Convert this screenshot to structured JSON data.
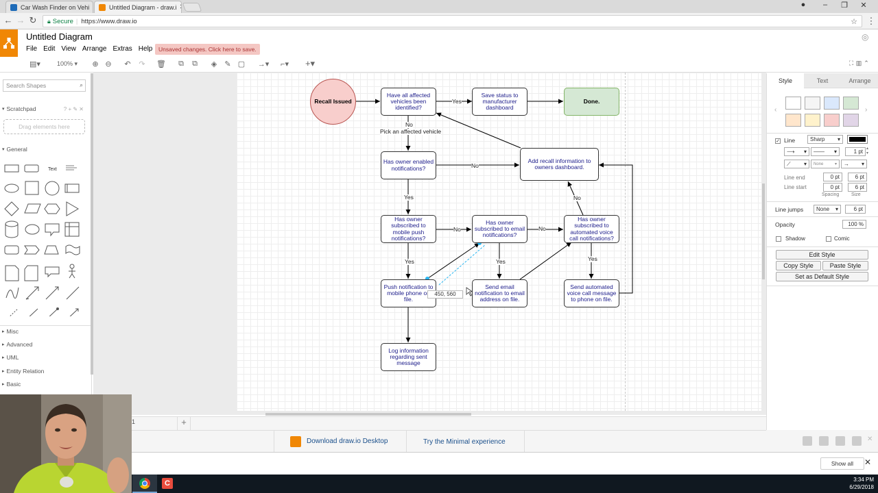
{
  "browser": {
    "tabs": [
      {
        "title": "Car Wash Finder on Vehi",
        "active": false
      },
      {
        "title": "Untitled Diagram - draw.i",
        "active": true
      }
    ],
    "secure_label": "Secure",
    "url": "https://www.draw.io"
  },
  "app": {
    "title": "Untitled Diagram",
    "menu": [
      "File",
      "Edit",
      "View",
      "Arrange",
      "Extras",
      "Help"
    ],
    "unsaved_notice": "Unsaved changes. Click here to save.",
    "zoom": "100%"
  },
  "sidebar": {
    "search_placeholder": "Search Shapes",
    "scratchpad_label": "Scratchpad",
    "scratchpad_hint": "Drag elements here",
    "general_label": "General",
    "text_shape_label": "Text",
    "sections": [
      "Misc",
      "Advanced",
      "UML",
      "Entity Relation",
      "Basic"
    ]
  },
  "diagram": {
    "nodes": {
      "recall": "Recall Issued",
      "identified": "Have all affected vehicles been identified?",
      "save_status": "Save status to manufacturer dashboard",
      "done": "Done.",
      "enabled": "Has owner enabled notifications?",
      "add_recall": "Add recall information to owners dashboard.",
      "push_sub": "Has owner subscribed to mobile push notifications?",
      "email_sub": "Has owner subscribed to email notifications?",
      "voice_sub": "Has owner subscribed to automated voice call notifications?",
      "push_send": "Push notification to mobile phone on file.",
      "email_send": "Send email notification to email address on file.",
      "voice_send": "Send automated voice call message to phone on file.",
      "log": "Log information regarding sent message"
    },
    "edge_labels": {
      "yes_top": "Yes",
      "no_top": "No",
      "pick": "Pick an affected vehicle",
      "no_enabled": "No",
      "yes_enabled": "Yes",
      "no_push": "No",
      "no_email": "No",
      "yes_push": "Yes",
      "yes_email": "Yes",
      "yes_voice": "Yes",
      "no_voice": "No"
    },
    "drag_tooltip": "450, 560"
  },
  "format_panel": {
    "tabs": [
      "Style",
      "Text",
      "Arrange"
    ],
    "line_label": "Line",
    "line_style": "Sharp",
    "line_width": "1 pt",
    "waypoint_none": "None",
    "line_end_label": "Line end",
    "line_start_label": "Line start",
    "line_end_spacing": "0 pt",
    "line_end_size": "6 pt",
    "line_start_spacing": "0 pt",
    "line_start_size": "6 pt",
    "spacing_label": "Spacing",
    "size_label": "Size",
    "line_jumps_label": "Line jumps",
    "line_jumps_value": "None",
    "line_jumps_size": "6 pt",
    "opacity_label": "Opacity",
    "opacity_value": "100 %",
    "shadow_label": "Shadow",
    "comic_label": "Comic",
    "edit_style": "Edit Style",
    "copy_style": "Copy Style",
    "paste_style": "Paste Style",
    "set_default": "Set as Default Style",
    "colors": {
      "swatches": [
        "#ffffff",
        "#f5f5f5",
        "#dae8fc",
        "#d5e8d4",
        "#ffe6cc",
        "#fff2cc",
        "#f8cecc",
        "#e1d5e7"
      ]
    }
  },
  "bottom": {
    "download_desktop": "Download draw.io Desktop",
    "minimal": "Try the Minimal experience",
    "show_all": "Show all"
  },
  "taskbar": {
    "time": "3:34 PM",
    "date": "6/29/2018"
  },
  "colors": {
    "accent": "#f08705",
    "recall_fill": "#f8cecc",
    "recall_stroke": "#b85450",
    "done_fill": "#d5e8d4",
    "done_stroke": "#82b366",
    "link": "#1a4f8b"
  }
}
